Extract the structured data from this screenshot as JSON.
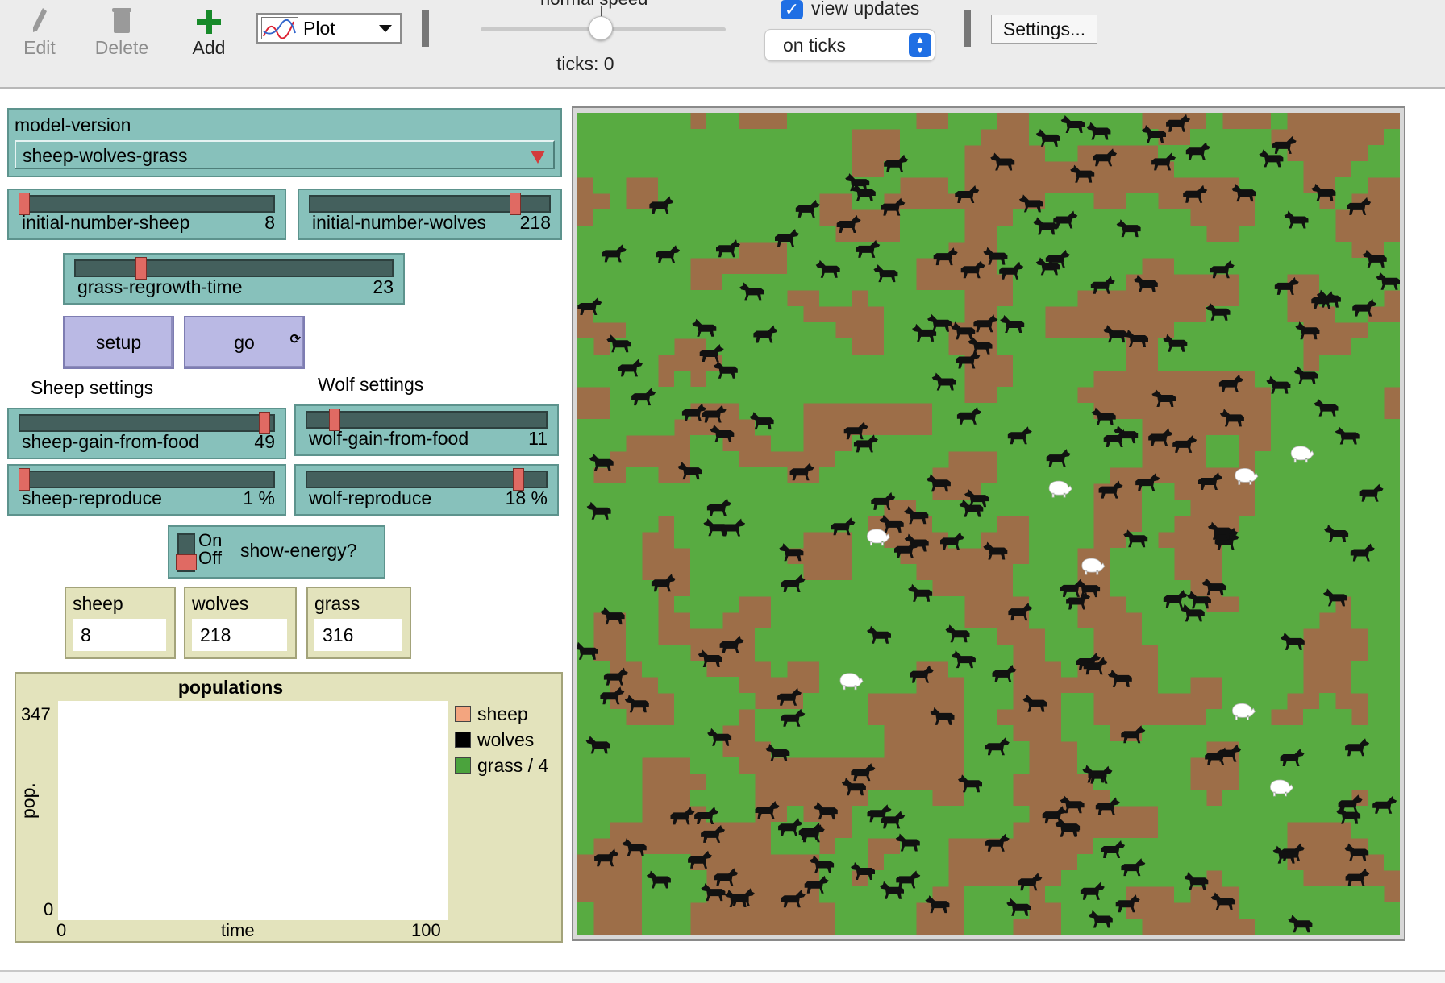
{
  "toolbar": {
    "edit_label": "Edit",
    "delete_label": "Delete",
    "add_label": "Add",
    "widget_type": "Plot",
    "speed_label": "normal speed",
    "ticks_label": "ticks: 0",
    "view_updates_label": "view updates",
    "view_updates_checked": true,
    "update_mode": "on ticks",
    "settings_label": "Settings..."
  },
  "model_version": {
    "label": "model-version",
    "value": "sheep-wolves-grass"
  },
  "sliders": {
    "initial_sheep": {
      "label": "initial-number-sheep",
      "value": "8",
      "fraction": 0.0
    },
    "initial_wolves": {
      "label": "initial-number-wolves",
      "value": "218",
      "fraction": 0.87
    },
    "grass_regrowth": {
      "label": "grass-regrowth-time",
      "value": "23",
      "fraction": 0.2
    },
    "sheep_gain": {
      "label": "sheep-gain-from-food",
      "value": "49",
      "fraction": 0.98
    },
    "wolf_gain": {
      "label": "wolf-gain-from-food",
      "value": "11",
      "fraction": 0.1
    },
    "sheep_reproduce": {
      "label": "sheep-reproduce",
      "value": "1 %",
      "fraction": 0.0
    },
    "wolf_reproduce": {
      "label": "wolf-reproduce",
      "value": "18 %",
      "fraction": 0.9
    }
  },
  "buttons": {
    "setup_label": "setup",
    "go_label": "go"
  },
  "sections": {
    "sheep_settings": "Sheep settings",
    "wolf_settings": "Wolf settings"
  },
  "show_energy": {
    "label": "show-energy?",
    "on_label": "On",
    "off_label": "Off",
    "state": "off"
  },
  "monitors": {
    "sheep": {
      "label": "sheep",
      "value": "8"
    },
    "wolves": {
      "label": "wolves",
      "value": "218"
    },
    "grass": {
      "label": "grass",
      "value": "316"
    }
  },
  "plot": {
    "title": "populations",
    "ylabel": "pop.",
    "xlabel": "time",
    "ymax": "347",
    "ymin": "0",
    "xmin": "0",
    "xmax": "100",
    "legend": [
      {
        "name": "sheep",
        "color": "#f3a57f"
      },
      {
        "name": "wolves",
        "color": "#000000"
      },
      {
        "name": "grass / 4",
        "color": "#4ba33d"
      }
    ]
  },
  "colors": {
    "grass": "#58ab41",
    "dirt": "#9d6e48",
    "wolf": "#111111",
    "sheep": "#ffffff"
  },
  "world": {
    "patches_per_side": 51,
    "sheep_count": 8,
    "wolf_count": 218
  }
}
